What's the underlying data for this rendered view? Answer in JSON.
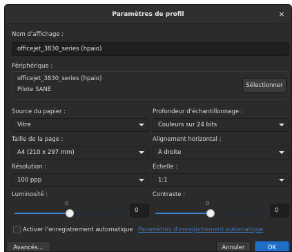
{
  "dialog": {
    "title": "Paramètres de profil",
    "close_glyph": "×"
  },
  "display_name": {
    "label": "Nom d'affichage :",
    "value": "officejet_3830_series (hpaio)"
  },
  "device": {
    "label": "Périphérique :",
    "name": "officejet_3830_series (hpaio)",
    "driver": "Pilote SANE",
    "select_button": "Sélectionner"
  },
  "paper_source": {
    "label": "Source du papier :",
    "value": "Vitre"
  },
  "sample_depth": {
    "label": "Profondeur d'échantillonnage :",
    "value": "Couleurs sur 24 bits"
  },
  "page_size": {
    "label": "Taille de la page :",
    "value": "A4 (210 x 297 mm)"
  },
  "horizontal_alignment": {
    "label": "Alignement horizontal :",
    "value": "À droite"
  },
  "resolution": {
    "label": "Résolution :",
    "value": "100 ppp"
  },
  "scale": {
    "label": "Échelle :",
    "value": "1:1"
  },
  "brightness": {
    "label": "Luminosité :",
    "slider_value": "0",
    "spin_value": "0",
    "level": 0.5
  },
  "contrast": {
    "label": "Contraste :",
    "slider_value": "0",
    "spin_value": "0",
    "level": 0.5
  },
  "autosave": {
    "checkbox_label": "Activer l'enregistrement automatique",
    "checked": false,
    "settings_link": "Paramètres d'enregistrement automatique"
  },
  "footer": {
    "advanced_button": "Avancés...",
    "cancel_button": "Annuler",
    "ok_button": "OK"
  },
  "colors": {
    "accent": "#1f6fc9",
    "slider_fill": "#3a84d9",
    "window_bg": "#2b2b2b"
  }
}
